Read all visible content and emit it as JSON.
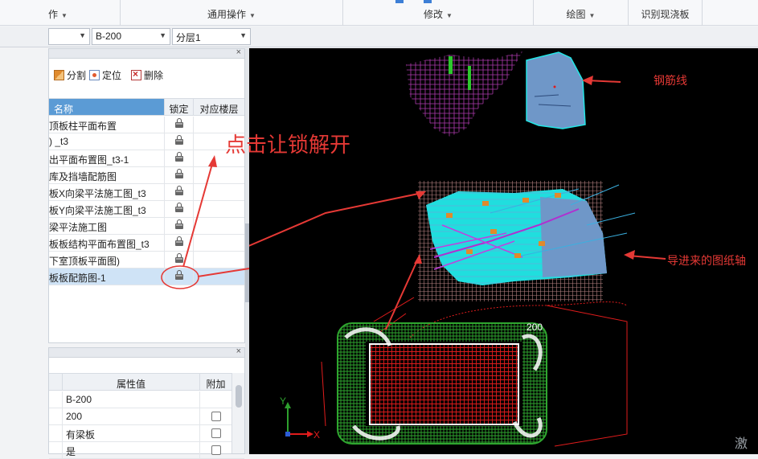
{
  "ribbon": {
    "groups": [
      {
        "label": "作",
        "has_caret": true
      },
      {
        "label": "通用操作",
        "has_caret": true
      },
      {
        "label": "修改",
        "has_caret": true
      },
      {
        "label": "绘图",
        "has_caret": true
      },
      {
        "label": "识别现浇板",
        "has_caret": false
      }
    ]
  },
  "toolbar2": {
    "combo1": "",
    "combo2": "B-200",
    "combo3": "分层1"
  },
  "drawing_panel": {
    "toolbar": {
      "split": "分割",
      "locate": "定位",
      "delete": "删除"
    },
    "columns": {
      "name": "名称",
      "lock": "锁定",
      "floor": "对应楼层"
    },
    "rows": [
      {
        "name": "顶板柱平面布置",
        "selected": false
      },
      {
        "name": ")  _t3",
        "selected": false
      },
      {
        "name": "出平面布置图_t3-1",
        "selected": false
      },
      {
        "name": "库及挡墙配筋图",
        "selected": false
      },
      {
        "name": "板X向梁平法施工图_t3",
        "selected": false
      },
      {
        "name": "板Y向梁平法施工图_t3",
        "selected": false
      },
      {
        "name": "梁平法施工图",
        "selected": false
      },
      {
        "name": "板板结构平面布置图_t3",
        "selected": false
      },
      {
        "name": "下室顶板平面图)",
        "selected": false
      },
      {
        "name": "板板配筋图-1",
        "selected": true
      }
    ]
  },
  "props_panel": {
    "columns": {
      "value": "属性值",
      "add": "附加"
    },
    "rows": [
      {
        "value": "B-200",
        "checkbox": false
      },
      {
        "value": "200",
        "checkbox": true
      },
      {
        "value": "有梁板",
        "checkbox": true
      },
      {
        "value": "是",
        "checkbox": true
      }
    ]
  },
  "canvas": {
    "annotations": {
      "rebar_line": "钢筋线",
      "click_unlock": "点击让锁解开",
      "imported_axis": "导进来的图纸轴"
    },
    "axis": {
      "x_label": "X",
      "y_label": "Y"
    },
    "watermark": "激活",
    "dim_text": "200"
  },
  "colors": {
    "annotation_red": "#e53935",
    "accent_blue": "#5b9bd5",
    "cad_cyan": "#22e6e6",
    "cad_steel": "#6f97c8",
    "cad_magenta": "#d040d0",
    "cad_green": "#2ea02e",
    "cad_red": "#d01818"
  }
}
